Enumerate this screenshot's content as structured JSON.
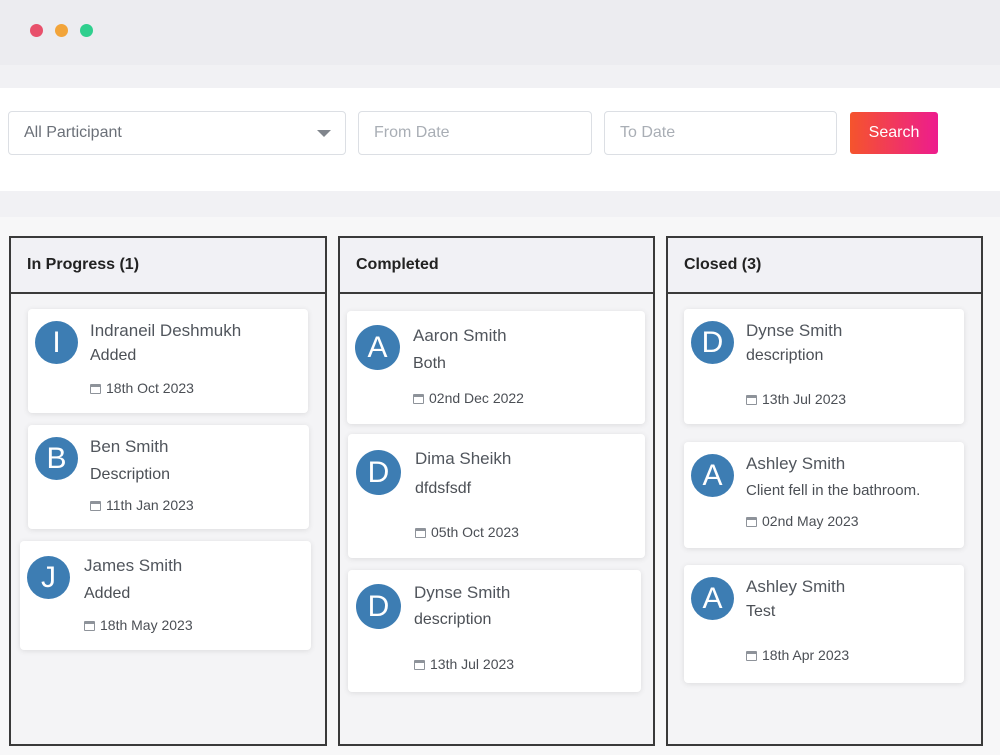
{
  "filters": {
    "participant_select": "All Participant",
    "from_date_placeholder": "From Date",
    "to_date_placeholder": "To Date",
    "search_label": "Search"
  },
  "columns": [
    {
      "title": "In Progress (1)",
      "cards": [
        {
          "initial": "I",
          "name": "Indraneil Deshmukh",
          "description": "Added",
          "date": "18th Oct 2023"
        },
        {
          "initial": "B",
          "name": "Ben Smith",
          "description": "Description",
          "date": "11th Jan 2023"
        },
        {
          "initial": "J",
          "name": "James Smith",
          "description": "Added",
          "date": "18th May 2023"
        }
      ]
    },
    {
      "title": "Completed",
      "cards": [
        {
          "initial": "A",
          "name": "Aaron Smith",
          "description": "Both",
          "date": "02nd Dec 2022"
        },
        {
          "initial": "D",
          "name": "Dima Sheikh",
          "description": "dfdsfsdf",
          "date": "05th Oct 2023"
        },
        {
          "initial": "D",
          "name": "Dynse Smith",
          "description": "description",
          "date": "13th Jul 2023"
        }
      ]
    },
    {
      "title": "Closed (3)",
      "cards": [
        {
          "initial": "D",
          "name": "Dynse Smith",
          "description": "description",
          "date": "13th Jul 2023"
        },
        {
          "initial": "A",
          "name": "Ashley Smith",
          "description": "Client fell in the bathroom.",
          "date": "02nd May 2023"
        },
        {
          "initial": "A",
          "name": "Ashley Smith",
          "description": "Test",
          "date": "18th Apr 2023"
        }
      ]
    }
  ],
  "colors": {
    "avatar": "#3d7db3",
    "search_gradient_start": "#f5542c",
    "search_gradient_end": "#ed1c8e",
    "window_close": "#e8506b",
    "window_minimize": "#f2a43a",
    "window_maximize": "#2fcf8e"
  }
}
